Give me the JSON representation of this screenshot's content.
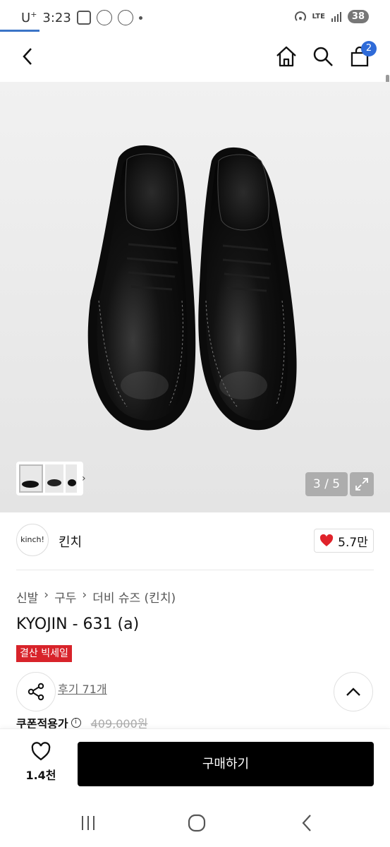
{
  "status_bar": {
    "carrier": "U",
    "carrier_sup": "+",
    "time": "3:23",
    "network": "LTE",
    "battery": "38"
  },
  "nav": {
    "back_icon": "chevron-left-icon",
    "home_icon": "home-icon",
    "search_icon": "search-icon",
    "cart_icon": "shopping-bag-icon",
    "cart_count": "2"
  },
  "gallery": {
    "counter": "3 / 5",
    "current_page": 3,
    "total_pages": 5
  },
  "brand": {
    "logo_text": "kinch!",
    "name": "킨치",
    "likes": "5.7만"
  },
  "product": {
    "breadcrumb": [
      "신발",
      "구두",
      "더비 슈즈 (킨치)"
    ],
    "title": "KYOJIN - 631 (a)",
    "sale_tag": "결산 빅세일",
    "reviews": "후기 71개",
    "coupon_label": "쿠폰적용가",
    "original_price": "409,000원"
  },
  "bottom_bar": {
    "wish_count": "1.4천",
    "buy_label": "구매하기"
  },
  "colors": {
    "accent_blue": "#2f6bd8",
    "sale_red": "#d8232a",
    "heart_red": "#e0232b",
    "buy_black": "#000000"
  }
}
